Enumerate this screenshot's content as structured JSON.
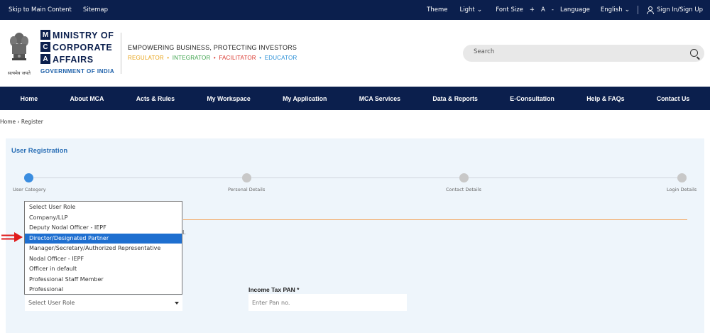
{
  "topbar": {
    "skip": "Skip to Main Content",
    "sitemap": "Sitemap",
    "theme_label": "Theme",
    "theme_value": "Light",
    "font_label": "Font Size",
    "font_plus": "+",
    "font_a": "A",
    "font_minus": "-",
    "lang_label": "Language",
    "lang_value": "English",
    "signin": "Sign In/Sign Up"
  },
  "header": {
    "mca_letters": [
      "M",
      "C",
      "A"
    ],
    "ministry_lines": [
      "MINISTRY OF",
      "CORPORATE",
      "AFFAIRS"
    ],
    "goi": "GOVERNMENT OF INDIA",
    "emblem_text": "सत्यमेव जयते",
    "tagline": "EMPOWERING BUSINESS, PROTECTING INVESTORS",
    "roles": [
      {
        "label": "REGULATOR",
        "color": "#e8a317"
      },
      {
        "label": "INTEGRATOR",
        "color": "#3aa14a"
      },
      {
        "label": "FACILITATOR",
        "color": "#d9342b"
      },
      {
        "label": "EDUCATOR",
        "color": "#2a8fd6"
      }
    ],
    "role_sep": "•",
    "search_placeholder": "Search"
  },
  "nav": [
    "Home",
    "About MCA",
    "Acts & Rules",
    "My Workspace",
    "My Application",
    "MCA Services",
    "Data & Reports",
    "E-Consultation",
    "Help & FAQs",
    "Contact Us"
  ],
  "breadcrumb": "Home › Register",
  "panel": {
    "title": "User Registration",
    "steps": [
      "User Category",
      "Personal Details",
      "Contact Details",
      "Login Details"
    ]
  },
  "dropdown": {
    "options": [
      "Select User Role",
      "Company/LLP",
      "Deputy Nodal Officer - IEPF",
      "Director/Designated Partner",
      "Manager/Secretary/Authorized Representative",
      "Nodal Officer - IEPF",
      "Officer in default",
      "Professional Staff Member",
      "Professional"
    ],
    "selected_index": 3,
    "closed_value": "Select User Role"
  },
  "partial_text": "l.",
  "pan": {
    "label": "Income Tax PAN *",
    "placeholder": "Enter Pan no."
  },
  "colors": {
    "navy": "#0b1f4d",
    "accent_blue": "#2a6fb6",
    "selected_option": "#1e6fd0",
    "arrow_red": "#e01b1b",
    "orange_line": "#f2a35a"
  }
}
